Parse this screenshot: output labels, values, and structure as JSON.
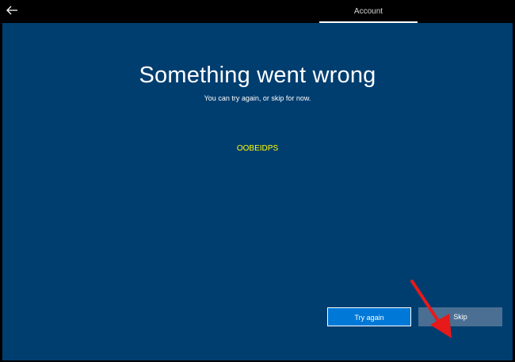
{
  "topbar": {
    "back_icon": "back-arrow-icon",
    "tab_label": "Account"
  },
  "main": {
    "title": "Something went wrong",
    "subtitle": "You can try again, or skip for now.",
    "error_code": "OOBEIDPS"
  },
  "buttons": {
    "try_again": "Try again",
    "skip": "Skip"
  },
  "colors": {
    "background": "#003e70",
    "accent": "#0078d7",
    "error_code": "#ffff00",
    "skip_button": "#4a6f93",
    "annotation_arrow": "#e8191a"
  }
}
